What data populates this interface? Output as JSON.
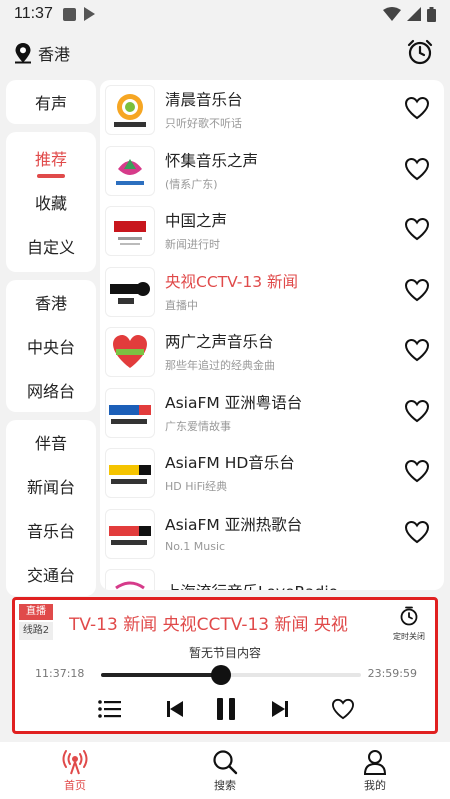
{
  "status_bar": {
    "time": "11:37"
  },
  "header": {
    "location": "香港"
  },
  "sidebar": {
    "groups": [
      [
        "有声"
      ],
      [
        "推荐",
        "收藏",
        "自定义"
      ],
      [
        "香港",
        "中央台",
        "网络台"
      ],
      [
        "伴音",
        "新闻台",
        "音乐台",
        "交通台"
      ]
    ],
    "active": "推荐"
  },
  "stations": [
    {
      "title": "清晨音乐台",
      "subtitle": "只听好歌不听话",
      "playing": false
    },
    {
      "title": "怀集音乐之声",
      "subtitle": "(情系广东)",
      "playing": false
    },
    {
      "title": "中国之声",
      "subtitle": "新闻进行时",
      "playing": false
    },
    {
      "title": "央视CCTV-13 新闻",
      "subtitle": "直播中",
      "playing": true
    },
    {
      "title": "两广之声音乐台",
      "subtitle": "那些年追过的经典金曲",
      "playing": false
    },
    {
      "title": "AsiaFM 亚洲粤语台",
      "subtitle": "广东爱情故事",
      "playing": false
    },
    {
      "title": "AsiaFM HD音乐台",
      "subtitle": "HD HiFi经典",
      "playing": false
    },
    {
      "title": "AsiaFM 亚洲热歌台",
      "subtitle": "No.1 Music",
      "playing": false
    },
    {
      "title": "上海流行音乐LoveRadio",
      "subtitle": "",
      "playing": false
    }
  ],
  "player": {
    "live_badge": "直播",
    "route_badge": "线路2",
    "marquee": "TV-13 新闻   央视CCTV-13 新闻   央视",
    "timer_label": "定时关闭",
    "program": "暂无节目内容",
    "time_start": "11:37:18",
    "time_end": "23:59:59",
    "progress": 0.46
  },
  "nav": [
    {
      "label": "首页",
      "icon": "radio-icon",
      "active": true
    },
    {
      "label": "搜索",
      "icon": "search-icon",
      "active": false
    },
    {
      "label": "我的",
      "icon": "user-icon",
      "active": false
    }
  ],
  "colors": {
    "accent": "#e04a4a",
    "highlight_border": "#e02020"
  }
}
